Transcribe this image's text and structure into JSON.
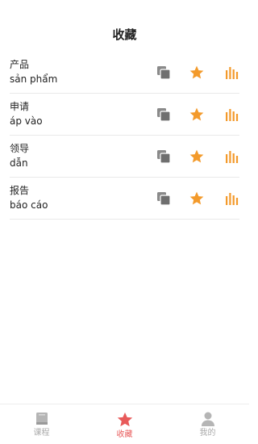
{
  "header": {
    "title": "收藏"
  },
  "colors": {
    "accent": "#f39a2b",
    "icon_gray": "#777777",
    "tab_active": "#e85a5a",
    "tab_inactive": "#aaaaaa"
  },
  "items": [
    {
      "word": "产品",
      "translation": "sản phẩm",
      "icons": [
        "copy-icon",
        "star-icon",
        "audio-bars-icon"
      ]
    },
    {
      "word": "申请",
      "translation": "áp vào",
      "icons": [
        "copy-icon",
        "star-icon",
        "audio-bars-icon"
      ]
    },
    {
      "word": "领导",
      "translation": "dẫn",
      "icons": [
        "copy-icon",
        "star-icon",
        "audio-bars-icon"
      ]
    },
    {
      "word": "报告",
      "translation": "báo cáo",
      "icons": [
        "copy-icon",
        "star-icon",
        "audio-bars-icon"
      ]
    }
  ],
  "tabbar": {
    "tabs": [
      {
        "label": "课程",
        "icon": "book-icon",
        "active": false
      },
      {
        "label": "收藏",
        "icon": "star-icon",
        "active": true
      },
      {
        "label": "我的",
        "icon": "person-icon",
        "active": false
      }
    ]
  }
}
